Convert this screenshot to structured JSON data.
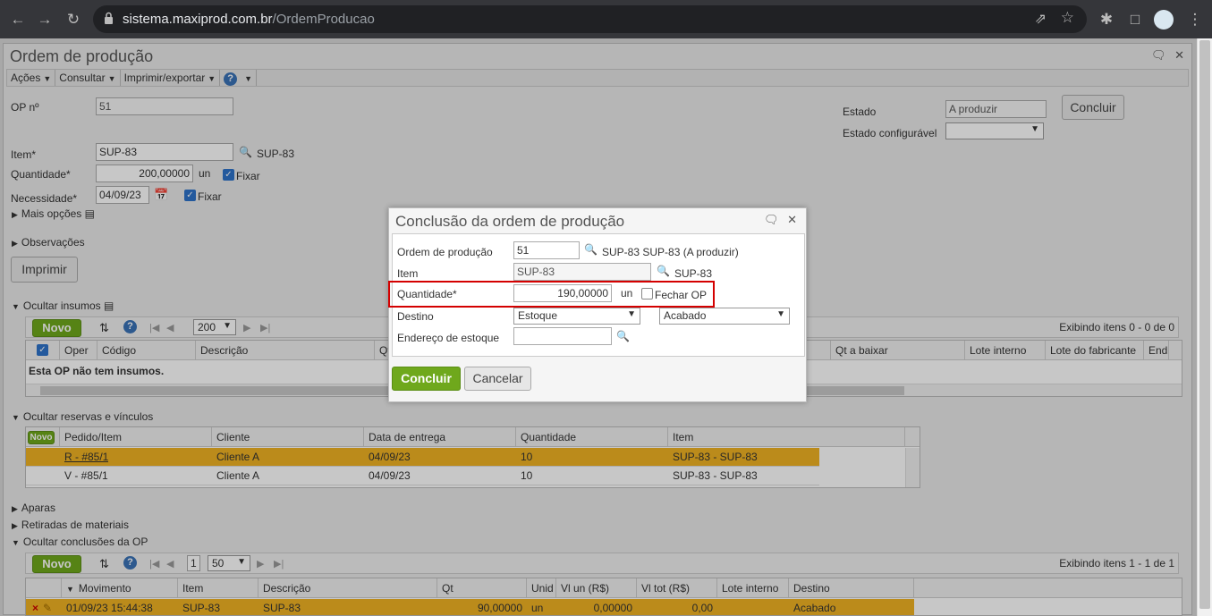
{
  "browser": {
    "url_domain": "sistema.maxiprod.com.br",
    "url_path": "/OrdemProducao"
  },
  "window": {
    "title": "Ordem de produção",
    "menu": {
      "acoes": "Ações",
      "consultar": "Consultar",
      "imprimir": "Imprimir/exportar",
      "help": "?"
    }
  },
  "form": {
    "op_label": "OP nº",
    "op_value": "51",
    "estado_label": "Estado",
    "estado_value": "A produzir",
    "estado_config_label": "Estado configurável",
    "concluir_label": "Concluir",
    "item_label": "Item*",
    "item_value": "SUP-83",
    "item_desc": "SUP-83",
    "quantidade_label": "Quantidade*",
    "quantidade_value": "200,00000",
    "quantidade_unit": "un",
    "fixar_label": "Fixar",
    "necessidade_label": "Necessidade*",
    "necessidade_value": "04/09/23",
    "mais_opcoes": "Mais opções",
    "observacoes": "Observações",
    "imprimir_label": "Imprimir"
  },
  "insumos": {
    "section_label": "Ocultar insumos",
    "novo_label": "Novo",
    "page_size": "200",
    "status": "Exibindo itens 0 - 0 de 0",
    "columns": [
      "Oper",
      "Código",
      "Descrição",
      "Qt",
      "Qt a baixar",
      "Lote interno",
      "Lote do fabricante",
      "End"
    ],
    "empty_message": "Esta OP não tem insumos."
  },
  "reservas": {
    "section_label": "Ocultar reservas e vínculos",
    "novo_label": "Novo",
    "columns": [
      "Pedido/Item",
      "Cliente",
      "Data de entrega",
      "Quantidade",
      "Item"
    ],
    "rows": [
      {
        "pedido": "R - #85/1",
        "cliente": "Cliente A",
        "data": "04/09/23",
        "quantidade": "10",
        "item": "SUP-83 - SUP-83"
      },
      {
        "pedido": "V - #85/1",
        "cliente": "Cliente A",
        "data": "04/09/23",
        "quantidade": "10",
        "item": "SUP-83 - SUP-83"
      }
    ]
  },
  "sections": {
    "aparas": "Aparas",
    "retiradas": "Retiradas de materiais",
    "conclusoes": "Ocultar conclusões da OP"
  },
  "conclusoes": {
    "novo_label": "Novo",
    "page_num": "1",
    "page_size": "50",
    "status": "Exibindo itens 1 - 1 de 1",
    "columns": [
      "Movimento",
      "Item",
      "Descrição",
      "Qt",
      "Unid",
      "Vl un (R$)",
      "Vl tot (R$)",
      "Lote interno",
      "Destino"
    ],
    "rows": [
      {
        "movimento": "01/09/23 15:44:38",
        "item": "SUP-83",
        "descricao": "SUP-83",
        "qt": "90,00000",
        "unid": "un",
        "vlun": "0,00000",
        "vltot": "0,00",
        "lote": "",
        "destino": "Acabado"
      }
    ]
  },
  "dialog": {
    "title": "Conclusão da ordem de produção",
    "ordem_label": "Ordem de produção",
    "ordem_value": "51",
    "ordem_desc": "SUP-83 SUP-83 (A produzir)",
    "item_label": "Item",
    "item_value": "SUP-83",
    "item_desc": "SUP-83",
    "quantidade_label": "Quantidade*",
    "quantidade_value": "190,00000",
    "quantidade_unit": "un",
    "fechar_label": "Fechar OP",
    "destino_label": "Destino",
    "destino_value": "Estoque",
    "destino2_value": "Acabado",
    "endereco_label": "Endereço de estoque",
    "concluir_label": "Concluir",
    "cancelar_label": "Cancelar"
  },
  "colors": {
    "accent_green": "#6fa81c",
    "row_selected": "#f0b323",
    "highlight_red": "#d40000"
  }
}
